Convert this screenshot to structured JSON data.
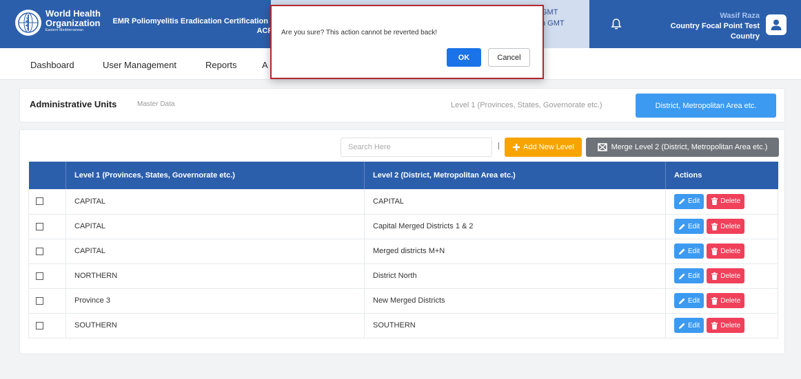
{
  "header": {
    "org_line1": "World Health",
    "org_line2": "Organization",
    "org_region": "Eastern Mediterranean",
    "app_title_line1": "EMR Poliomyelitis Eradication Certification D",
    "app_title_line2": "ACR)",
    "time_line1": "GMT",
    "time_line2": "h GMT",
    "user_name": "Wasif Raza",
    "user_role_line1": "Country Focal Point Test",
    "user_role_line2": "Country"
  },
  "nav": {
    "items": [
      "Dashboard",
      "User Management",
      "Reports",
      "A"
    ]
  },
  "units_card": {
    "title": "Administrative Units",
    "subtitle": "Master Data",
    "level1_link": "Level 1 (Provinces, States, Governorate etc.)",
    "level2_button": "District, Metropolitan Area etc."
  },
  "toolbar": {
    "search_placeholder": "Search Here",
    "separator": "|",
    "add_label": "Add New Level",
    "merge_label": "Merge Level 2 (District, Metropolitan Area etc.)"
  },
  "table": {
    "columns": [
      "",
      "Level 1 (Provinces, States, Governorate etc.)",
      "Level 2 (District, Metropolitan Area etc.)",
      "Actions"
    ],
    "rows": [
      {
        "level1": "CAPITAL",
        "level2": "CAPITAL"
      },
      {
        "level1": "CAPITAL",
        "level2": "Capital Merged Districts 1 & 2"
      },
      {
        "level1": "CAPITAL",
        "level2": "Merged districts M+N"
      },
      {
        "level1": "NORTHERN",
        "level2": "District North"
      },
      {
        "level1": "Province 3",
        "level2": "New Merged Districts"
      },
      {
        "level1": "SOUTHERN",
        "level2": "SOUTHERN"
      }
    ],
    "edit_label": "Edit",
    "delete_label": "Delete"
  },
  "dialog": {
    "message": "Are you sure? This action cannot be reverted back!",
    "ok_label": "OK",
    "cancel_label": "Cancel"
  },
  "colors": {
    "header_blue": "#2c5fab",
    "primary_blue": "#3c9af0",
    "add_orange": "#f7a400",
    "delete_red": "#f0405a",
    "dialog_border": "#b3262e"
  }
}
